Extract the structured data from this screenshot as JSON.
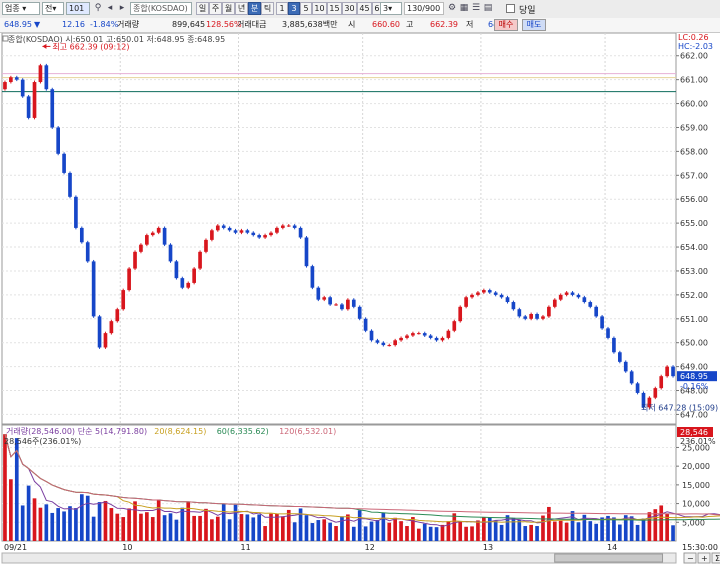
{
  "toolbar": {
    "sector_label": "업종",
    "market_label": "전",
    "code": "101",
    "index_name": "종합(KOSDAO)",
    "period_buttons": [
      "일",
      "주",
      "월",
      "년",
      "분",
      "틱"
    ],
    "active_period": "분",
    "interval_buttons": [
      "1",
      "3",
      "5",
      "10",
      "15",
      "30",
      "45",
      "60"
    ],
    "active_interval": "3",
    "interval_select": "3",
    "count": "130/900",
    "today_label": "당일"
  },
  "infobar": {
    "price": "648.95",
    "change_arrow": "▼",
    "change": "12.16",
    "change_pct": "-1.84%",
    "volume_label": "거래량",
    "volume": "899,645",
    "volume_ratio": "128.56%",
    "amount_label": "거래대금",
    "amount": "3,885,638백만",
    "open_label": "시",
    "open": "660.60",
    "high_label": "고",
    "high": "662.39",
    "low_label": "저",
    "low": "647.28",
    "buy_label": "매수",
    "sell_label": "매도"
  },
  "colors": {
    "up": "#d8161d",
    "down": "#1646c8",
    "hline": "#0d6b5b",
    "label_bg": "#d8161d"
  },
  "chart_data": [
    {
      "type": "candlestick",
      "title": "종합(KOSDAO) 시:650.01 고:650.01 저:648.95 종:648.95",
      "series_name": "종합(KOSDAO)",
      "ylim": [
        646.6,
        662.7
      ],
      "y_ticks": [
        647,
        648,
        649,
        650,
        651,
        652,
        653,
        654,
        655,
        656,
        657,
        658,
        659,
        660,
        661,
        662
      ],
      "x_labels": [
        "09/21",
        "10",
        "11",
        "12",
        "13",
        "14",
        "15"
      ],
      "x_label_indices": [
        0,
        20,
        40,
        61,
        81,
        102,
        122
      ],
      "top_right_labels": [
        "LC:0.26",
        "HC:-2.03"
      ],
      "last_price_label": "648.95",
      "last_change_label": "-0.16%",
      "hline_value": 660.5,
      "annotations": [
        {
          "text": "최고 662.39 (09:12)",
          "index": 6,
          "value": 662.39,
          "side": "right"
        },
        {
          "text": "최저 647.28 (15:09)",
          "index": 123,
          "value": 647.28,
          "side": "left"
        }
      ],
      "close": [
        660.9,
        661.1,
        661.0,
        660.3,
        659.4,
        660.9,
        661.6,
        660.6,
        659.0,
        657.9,
        657.1,
        656.1,
        654.8,
        654.2,
        653.4,
        651.1,
        649.8,
        650.4,
        650.9,
        651.4,
        652.2,
        653.1,
        653.8,
        654.1,
        654.5,
        654.6,
        654.8,
        654.1,
        653.4,
        652.7,
        652.3,
        652.5,
        653.1,
        653.8,
        654.3,
        654.7,
        654.9,
        654.8,
        654.7,
        654.6,
        654.7,
        654.6,
        654.5,
        654.4,
        654.5,
        654.6,
        654.8,
        654.9,
        654.9,
        654.8,
        654.4,
        653.2,
        652.3,
        651.8,
        651.9,
        651.6,
        651.6,
        651.4,
        651.8,
        651.5,
        651.0,
        650.5,
        650.1,
        650.0,
        649.9,
        649.9,
        650.1,
        650.2,
        650.3,
        650.4,
        650.4,
        650.3,
        650.2,
        650.1,
        650.2,
        650.5,
        650.9,
        651.5,
        651.9,
        652.0,
        652.1,
        652.2,
        652.1,
        652.0,
        651.9,
        651.7,
        651.4,
        651.1,
        651.0,
        651.2,
        651.0,
        651.1,
        651.5,
        651.8,
        652.0,
        652.1,
        652.0,
        651.9,
        651.7,
        651.5,
        651.1,
        650.6,
        650.2,
        649.6,
        649.2,
        648.8,
        648.3,
        647.9,
        647.3,
        647.7,
        648.1,
        648.6,
        649.0,
        648.6
      ]
    },
    {
      "type": "bar",
      "title": "거래량(28,546.00)",
      "legend": [
        "거래량(28,546.00)",
        "단순 5(14,791.80)",
        "20(8,624.15)",
        "60(6,335.62)",
        "120(6,532.01)"
      ],
      "value_label": "28,546주(236.01%)",
      "last_volume_label": "28,546",
      "last_pct_label": "236.01%",
      "ylim": [
        0,
        31000
      ],
      "y_ticks": [
        5000,
        10000,
        15000,
        20000,
        25000
      ],
      "y_tick_labels": [
        "5,000",
        "10,000",
        "15,000",
        "20,000",
        "25,000"
      ],
      "values": [
        28546,
        16500,
        27500,
        9500,
        14800,
        11400,
        8900,
        9800,
        7500,
        8800,
        7900,
        9300,
        8800,
        12500,
        12100,
        6500,
        10400,
        10700,
        8800,
        7300,
        6400,
        8700,
        10600,
        7300,
        7700,
        6400,
        11100,
        6900,
        7400,
        5700,
        8900,
        10400,
        6700,
        6700,
        8600,
        5800,
        6500,
        9900,
        5800,
        9700,
        7200,
        7100,
        6300,
        7100,
        4000,
        7300,
        7300,
        6600,
        8300,
        5000,
        8700,
        6900,
        4800,
        5600,
        5800,
        4900,
        4000,
        6600,
        7100,
        3800,
        8200,
        3900,
        5200,
        5600,
        7500,
        4900,
        6200,
        5300,
        4000,
        6400,
        3300,
        4600,
        3800,
        3700,
        4300,
        5300,
        7400,
        5200,
        3800,
        3900,
        5500,
        6300,
        6300,
        5500,
        4300,
        6900,
        6200,
        5700,
        4000,
        4300,
        4000,
        6800,
        9100,
        5200,
        5400,
        4900,
        8000,
        5000,
        7000,
        5300,
        4600,
        6300,
        6700,
        6300,
        4400,
        6900,
        6600,
        4300,
        6000,
        7700,
        8500,
        9500,
        7300,
        4200,
        5500,
        6000,
        9300,
        7400,
        4600,
        8900,
        6300,
        7900,
        7300,
        10200,
        10900,
        9700,
        12200,
        17500,
        28546
      ]
    }
  ],
  "status": {
    "time": "15:30:00",
    "controls": [
      "−",
      "+",
      "Σ"
    ]
  }
}
